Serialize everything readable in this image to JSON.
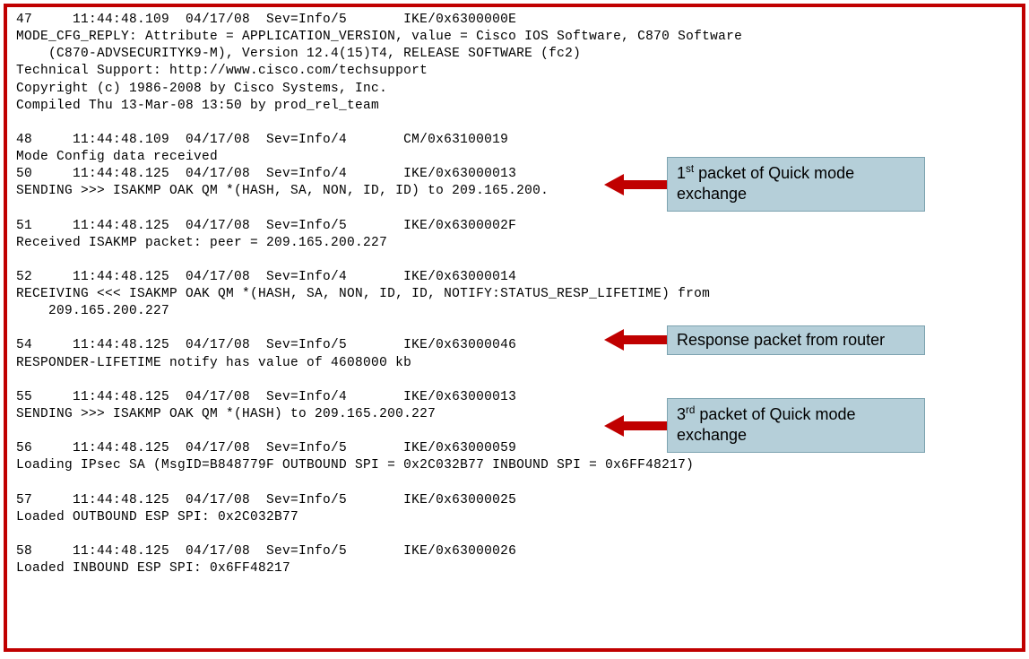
{
  "log": {
    "l1": "47     11:44:48.109  04/17/08  Sev=Info/5\tIKE/0x6300000E",
    "l2": "MODE_CFG_REPLY: Attribute = APPLICATION_VERSION, value = Cisco IOS Software, C870 Software",
    "l3": "    (C870-ADVSECURITYK9-M), Version 12.4(15)T4, RELEASE SOFTWARE (fc2)",
    "l4": "Technical Support: http://www.cisco.com/techsupport",
    "l5": "Copyright (c) 1986-2008 by Cisco Systems, Inc.",
    "l6": "Compiled Thu 13-Mar-08 13:50 by prod_rel_team",
    "l7": "",
    "l8": "48     11:44:48.109  04/17/08  Sev=Info/4\tCM/0x63100019",
    "l9": "Mode Config data received",
    "l10": "50     11:44:48.125  04/17/08  Sev=Info/4\tIKE/0x63000013",
    "l11": "SENDING >>> ISAKMP OAK QM *(HASH, SA, NON, ID, ID) to 209.165.200.",
    "l12": "",
    "l13": "51     11:44:48.125  04/17/08  Sev=Info/5\tIKE/0x6300002F",
    "l14": "Received ISAKMP packet: peer = 209.165.200.227",
    "l15": "",
    "l16": "52     11:44:48.125  04/17/08  Sev=Info/4\tIKE/0x63000014",
    "l17": "RECEIVING <<< ISAKMP OAK QM *(HASH, SA, NON, ID, ID, NOTIFY:STATUS_RESP_LIFETIME) from",
    "l18": "    209.165.200.227",
    "l19": "",
    "l20": "54     11:44:48.125  04/17/08  Sev=Info/5\tIKE/0x63000046",
    "l21": "RESPONDER-LIFETIME notify has value of 4608000 kb",
    "l22": "",
    "l23": "55     11:44:48.125  04/17/08  Sev=Info/4\tIKE/0x63000013",
    "l24": "SENDING >>> ISAKMP OAK QM *(HASH) to 209.165.200.227",
    "l25": "",
    "l26": "56     11:44:48.125  04/17/08  Sev=Info/5\tIKE/0x63000059",
    "l27": "Loading IPsec SA (MsgID=B848779F OUTBOUND SPI = 0x2C032B77 INBOUND SPI = 0x6FF48217)",
    "l28": "",
    "l29": "57     11:44:48.125  04/17/08  Sev=Info/5\tIKE/0x63000025",
    "l30": "Loaded OUTBOUND ESP SPI: 0x2C032B77",
    "l31": "",
    "l32": "58     11:44:48.125  04/17/08  Sev=Info/5\tIKE/0x63000026",
    "l33": "Loaded INBOUND ESP SPI: 0x6FF48217"
  },
  "annotations": {
    "a1_pre": "1",
    "a1_sup": "st",
    "a1_post": " packet of Quick mode exchange",
    "a2": "Response packet from router",
    "a3_pre": "3",
    "a3_sup": "rd",
    "a3_post": " packet of Quick mode exchange"
  }
}
